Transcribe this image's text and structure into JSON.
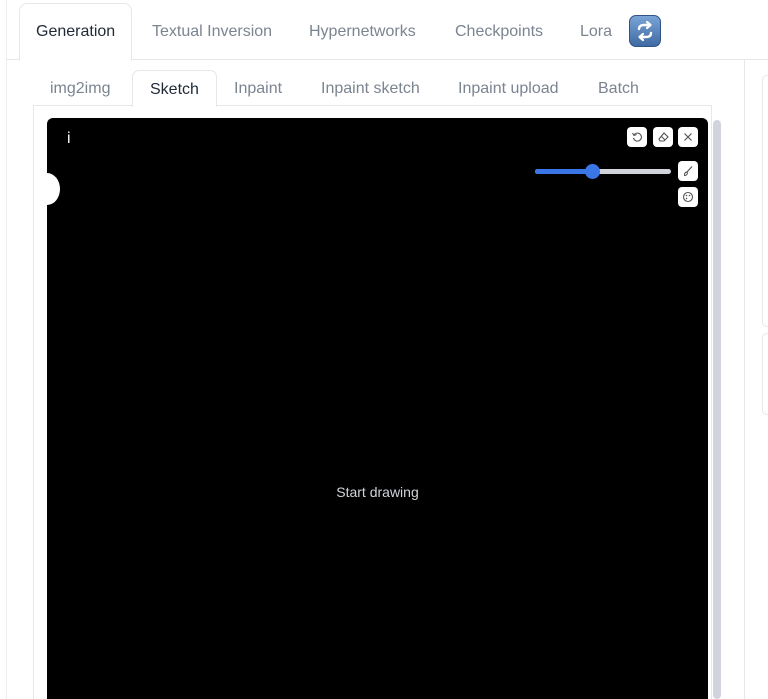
{
  "top_tabs": [
    {
      "label": "Generation",
      "active": true
    },
    {
      "label": "Textual Inversion",
      "active": false
    },
    {
      "label": "Hypernetworks",
      "active": false
    },
    {
      "label": "Checkpoints",
      "active": false
    },
    {
      "label": "Lora",
      "active": false
    }
  ],
  "refresh_icon": "refresh-icon",
  "sub_tabs": [
    {
      "label": "img2img",
      "active": false
    },
    {
      "label": "Sketch",
      "active": true
    },
    {
      "label": "Inpaint",
      "active": false
    },
    {
      "label": "Inpaint sketch",
      "active": false
    },
    {
      "label": "Inpaint upload",
      "active": false
    },
    {
      "label": "Batch",
      "active": false
    }
  ],
  "canvas": {
    "info_glyph": "i",
    "placeholder": "Start drawing",
    "brush_size_fraction": 0.42,
    "tools": [
      "undo-icon",
      "eraser-icon",
      "close-icon",
      "brush-icon",
      "color-palette-icon"
    ]
  },
  "colors": {
    "accent": "#3b76e8",
    "canvas_bg": "#000000",
    "refresh_button": "#4f7ab3"
  }
}
